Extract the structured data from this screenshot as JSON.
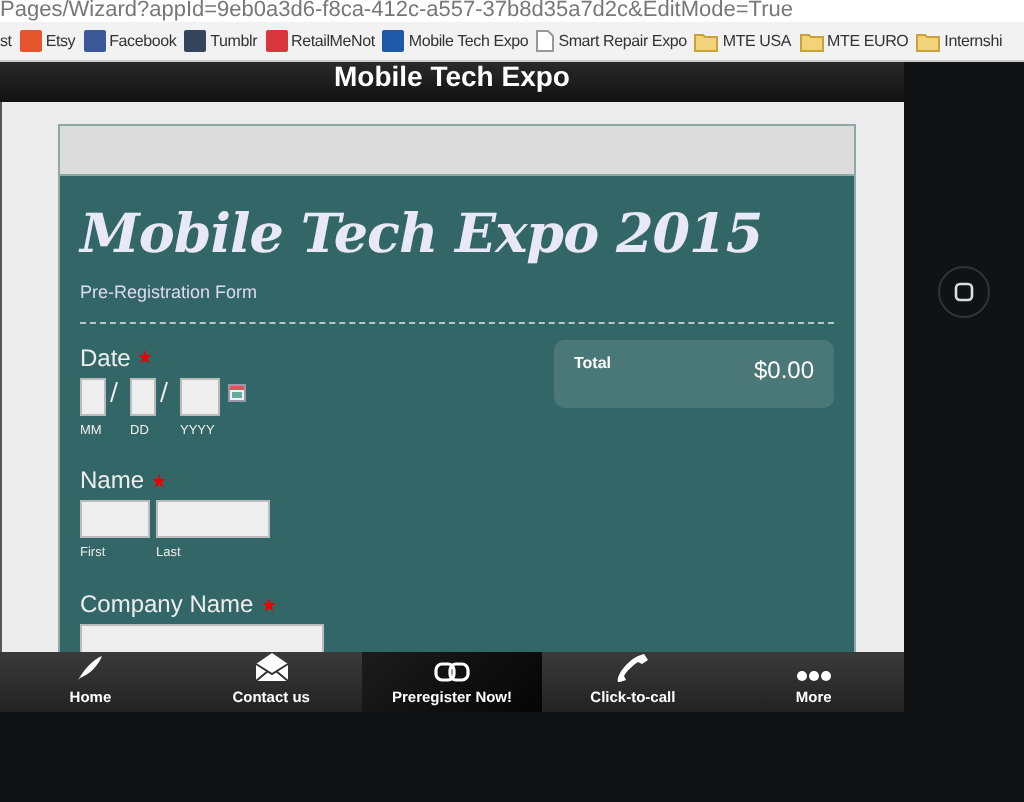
{
  "browser": {
    "url": "Pages/Wizard?appId=9eb0a3d6-f8ca-412c-a557-37b8d35a7d2c&EditMode=True",
    "bookmarks": [
      {
        "label": "st",
        "kind": "none"
      },
      {
        "label": "Etsy",
        "kind": "site",
        "color": "#e4572e"
      },
      {
        "label": "Facebook",
        "kind": "site",
        "color": "#3b5998"
      },
      {
        "label": "Tumblr",
        "kind": "site",
        "color": "#35465c"
      },
      {
        "label": "RetailMeNot",
        "kind": "site",
        "color": "#d9363e"
      },
      {
        "label": "Mobile Tech Expo",
        "kind": "site",
        "color": "#1e5aa8"
      },
      {
        "label": "Smart Repair Expo",
        "kind": "page"
      },
      {
        "label": "MTE USA",
        "kind": "folder"
      },
      {
        "label": "MTE EURO",
        "kind": "folder"
      },
      {
        "label": "Internshi",
        "kind": "folder"
      }
    ]
  },
  "app": {
    "header": "Mobile Tech Expo",
    "form": {
      "title": "Mobile Tech Expo 2015",
      "subtitle": "Pre-Registration Form",
      "fields": [
        {
          "kind": "date",
          "label": "Date",
          "required": true,
          "parts": [
            "MM",
            "DD",
            "YYYY"
          ]
        },
        {
          "kind": "name",
          "label": "Name",
          "required": true,
          "parts": [
            "First",
            "Last"
          ]
        },
        {
          "kind": "text",
          "label": "Company Name",
          "required": true
        }
      ],
      "total": {
        "label": "Total",
        "amount": "$0.00"
      }
    },
    "tabs": [
      {
        "label": "Home",
        "selected": false
      },
      {
        "label": "Contact us",
        "selected": false
      },
      {
        "label": "Preregister Now!",
        "selected": true
      },
      {
        "label": "Click-to-call",
        "selected": false
      },
      {
        "label": "More",
        "selected": false
      }
    ]
  }
}
